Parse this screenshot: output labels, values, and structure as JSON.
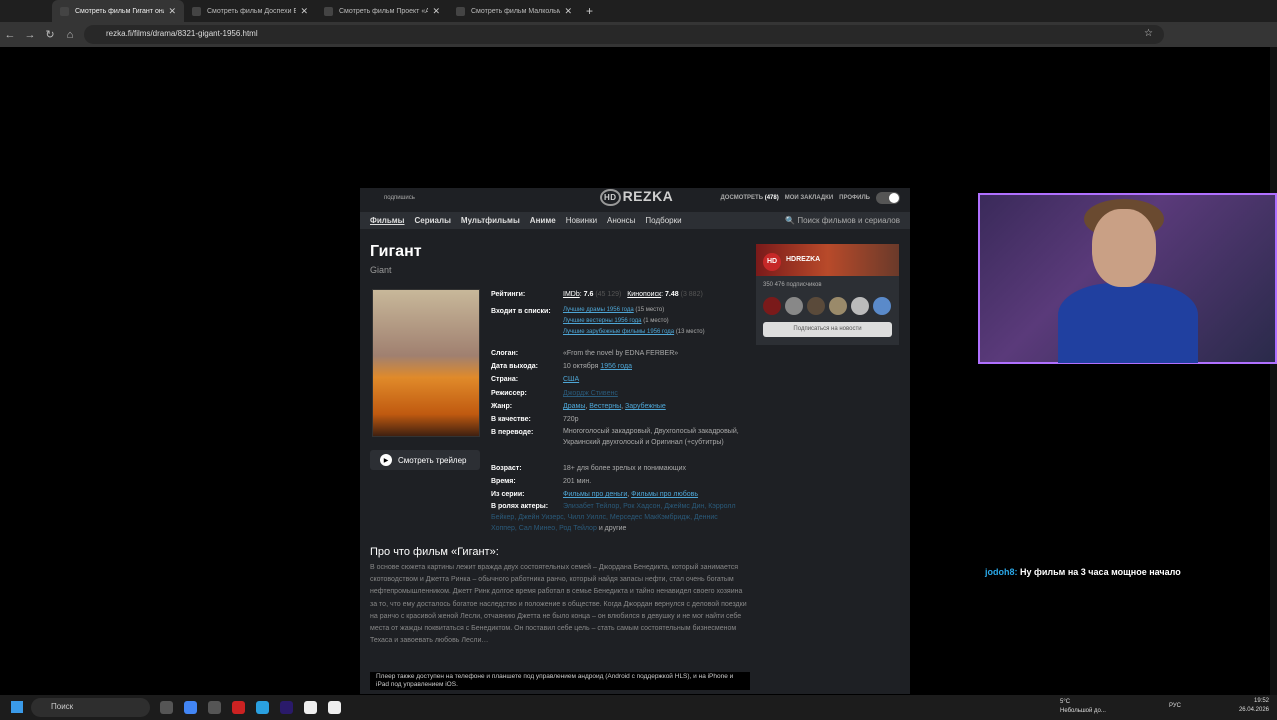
{
  "browser": {
    "tabs": [
      {
        "title": "Смотреть фильм Гигант онлайн"
      },
      {
        "title": "Смотреть фильм Доспехи Бога"
      },
      {
        "title": "Смотреть фильм Проект «Аце"
      },
      {
        "title": "Смотреть фильм Малкольм Икс"
      }
    ],
    "new_tab": "+",
    "url": "rezka.fi/films/drama/8321-gigant-1956.html"
  },
  "site": {
    "subscribe": "подпишись",
    "logo_hd": "HD",
    "logo": "REZKA",
    "later": "ДОСМОТРЕТЬ",
    "later_count": "(478)",
    "bookmarks": "МОИ ЗАКЛАДКИ",
    "profile": "ПРОФИЛЬ",
    "nav": [
      "Фильмы",
      "Сериалы",
      "Мультфильмы",
      "Аниме",
      "Новинки",
      "Анонсы",
      "Подборки"
    ],
    "search_placeholder": "Поиск фильмов и сериалов",
    "title": "Гигант",
    "original": "Giant",
    "trailer": "Смотреть трейлер",
    "ratings_label": "Рейтинги:",
    "imdb": "IMDb",
    "imdb_score": "7.6",
    "imdb_votes": "(45 129)",
    "kp": "Кинопоиск",
    "kp_score": "7.48",
    "kp_votes": "(3 882)",
    "lists_label": "Входит в списки:",
    "lists": [
      {
        "t": "Лучшие драмы 1956 года",
        "p": "(15 место)"
      },
      {
        "t": "Лучшие вестерны 1956 года",
        "p": "(1 место)"
      },
      {
        "t": "Лучшие зарубежные фильмы 1956 года",
        "p": "(13 место)"
      }
    ],
    "slogan_label": "Слоган:",
    "slogan": "«From the novel by EDNA FERBER»",
    "date_label": "Дата выхода:",
    "date": "10 октября",
    "year": "1956 года",
    "country_label": "Страна:",
    "country": "США",
    "director_label": "Режиссер:",
    "director": "Джордж Стивенс",
    "genre_label": "Жанр:",
    "genres": [
      "Драмы",
      "Вестерны",
      "Зарубежные"
    ],
    "quality_label": "В качестве:",
    "quality": "720p",
    "transl_label": "В переводе:",
    "transl": "Многоголосый закадровый, Двухголосый закадровый, Украинский двухголосый и Оригинал (+субтитры)",
    "age_label": "Возраст:",
    "age": "18+ для более зрелых и понимающих",
    "time_label": "Время:",
    "time": "201 мин.",
    "series_label": "Из серии:",
    "series": [
      "Фильмы про деньги",
      "Фильмы про любовь"
    ],
    "cast_label": "В ролях актеры:",
    "cast": "Элизабет Тейлор, Рок Хадсон, Джеймс Дин, Кэрролл Бейкер, Джейн Уизерс, Чилл Уиллс, Мерседес МакКэмбридж, Деннис Хоппер, Сал Минео, Род Тейлор",
    "cast_more": "и другие",
    "about_title": "Про что фильм «Гигант»:",
    "description": "В основе сюжета картины лежит вражда двух состоятельных семей – Джордана Бенедикта, который занимается скотоводством и Джетта Ринка – обычного работника ранчо, который найдя запасы нефти, стал очень богатым нефтепромышленником. Джетт Ринк долгое время работал в семье Бенедикта и тайно ненавидел своего хозяина за то, что ему досталось богатое наследство и положение в обществе. Когда Джордан вернулся с деловой поездки на ранчо с красивой женой Лесли, отчаянию Джетта не было конца – он влюбился в девушку и не мог найти себе места от жажды поквитаться с Бенедиктом. Он поставил себе цель – стать самым состоятельным бизнесменом Техаса и завоевать любовь Лесли…",
    "player_note": "Плеер также доступен на телефоне и планшете под управлением андроид (Android с поддержкой HLS), и на iPhone и iPad под управлением iOS.",
    "vk_name": "HDREZKA",
    "vk_subs": "350 476 подписчиков",
    "vk_btn": "Подписаться на новости",
    "vk_logo": "HD"
  },
  "chat": {
    "user": "jodoh8:",
    "message": "Ну фильм на 3 часа мощное начало"
  },
  "taskbar": {
    "search": "Поиск",
    "weather_temp": "5°C",
    "weather_desc": "Небольшой до...",
    "lang": "РУС",
    "time": "19:52",
    "date": "26.04.2026"
  }
}
